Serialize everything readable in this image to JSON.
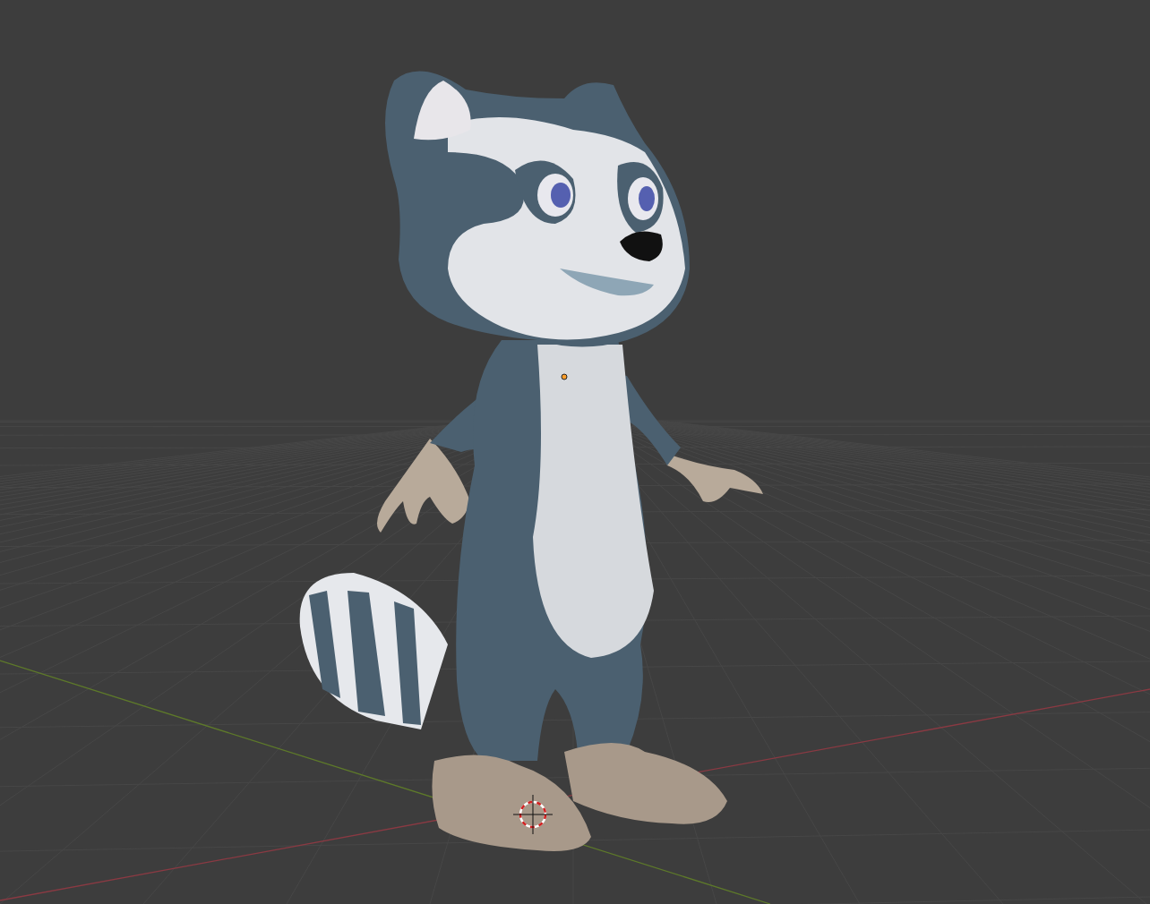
{
  "viewport": {
    "kind": "perspective"
  }
}
